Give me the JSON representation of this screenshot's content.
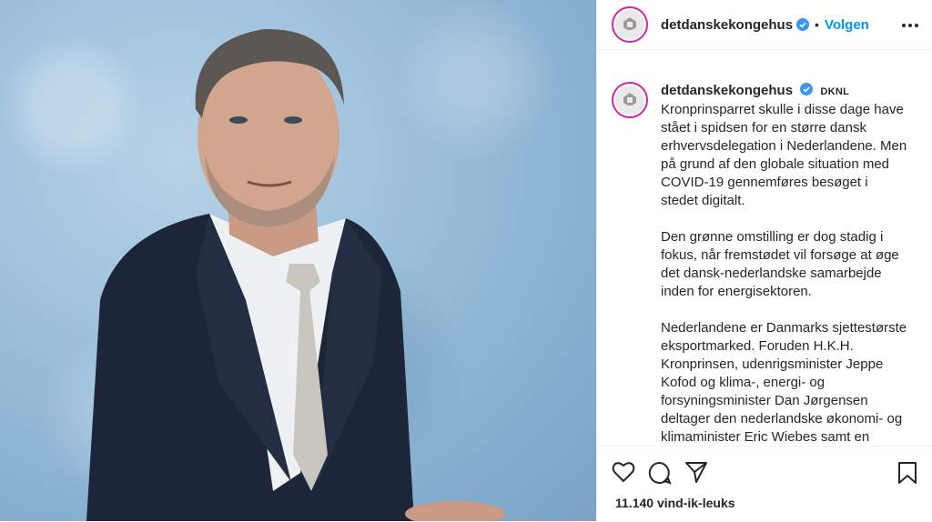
{
  "header": {
    "username": "detdanskekongehus",
    "separator": "•",
    "follow_label": "Volgen"
  },
  "caption": {
    "username": "detdanskekongehus",
    "tag": "DKNL",
    "paragraphs": [
      "Kronprinsparret skulle i disse dage have stået i spidsen for en større dansk erhvervsdelegation i Nederlandene. Men på grund af den globale situation med COVID-19 gennemføres besøget i stedet digitalt.",
      "Den grønne omstilling er dog stadig i fokus, når fremstødet vil forsøge at øge det dansk-nederlandske samarbejde inden for energisektoren.",
      "Nederlandene er Danmarks sjettestørste eksportmarked. Foruden H.K.H. Kronprinsen, udenrigsminister Jeppe Kofod og klima-, energi- og forsyningsminister Dan Jørgensen deltager den nederlandske økonomi- og klimaminister Eric Wiebes samt en"
    ]
  },
  "stats": {
    "likes": "11.140 vind-ik-leuks"
  },
  "colors": {
    "accent": "#0095f6",
    "verified": "#3897f0",
    "photo_background": "#9cc0dc",
    "suit": "#1d2638"
  },
  "icons": {
    "like": "heart-icon",
    "comment": "comment-icon",
    "share": "paper-plane-icon",
    "save": "bookmark-icon",
    "more": "more-dots-icon"
  }
}
